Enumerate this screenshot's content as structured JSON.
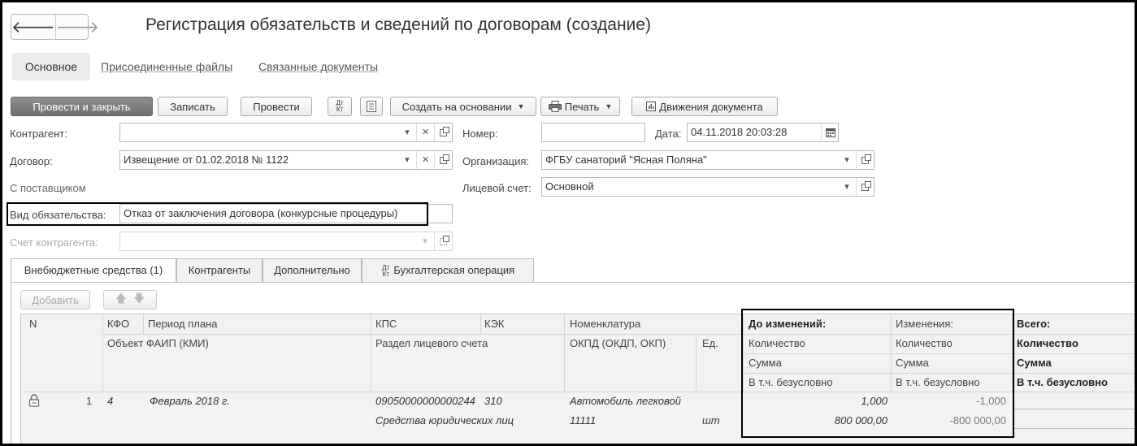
{
  "window": {
    "title": "Регистрация обязательств и сведений по договорам (создание)"
  },
  "nav": {
    "back": "🡐",
    "forward": "🡒"
  },
  "top_tabs": [
    {
      "label": "Основное"
    },
    {
      "label": "Присоединенные файлы"
    },
    {
      "label": "Связанные документы"
    }
  ],
  "toolbar": {
    "post_close": "Провести и закрыть",
    "save": "Записать",
    "post": "Провести",
    "dtkt": "Дт Кт",
    "create_based": "Создать на основании",
    "print": "Печать",
    "movements": "Движения документа"
  },
  "form": {
    "counterparty_label": "Контрагент:",
    "counterparty_value": "",
    "number_label": "Номер:",
    "number_value": "",
    "date_label": "Дата:",
    "date_value": "04.11.2018 20:03:28",
    "contract_label": "Договор:",
    "contract_value": "Извещение от 01.02.2018 № 1122",
    "org_label": "Организация:",
    "org_value": "ФГБУ санаторий \"Ясная Поляна\"",
    "supplier_text": "С поставщиком",
    "account_label": "Лицевой счет:",
    "account_value": "Основной",
    "obligation_label": "Вид обязательства:",
    "obligation_value": "Отказ от заключения договора (конкурсные процедуры)",
    "cp_account_label": "Счет контрагента:",
    "cp_account_value": ""
  },
  "tabs": [
    {
      "label": "Внебюджетные средства (1)"
    },
    {
      "label": "Контрагенты"
    },
    {
      "label": "Дополнительно"
    },
    {
      "label": "Бухгалтерская операция"
    }
  ],
  "grid_toolbar": {
    "add": "Добавить"
  },
  "grid": {
    "headers": {
      "n": "N",
      "kfo": "КФО",
      "period": "Период плана",
      "object": "Объект ФАИП (КМИ)",
      "kps": "КПС",
      "kek": "КЭК",
      "section": "Раздел лицевого счета",
      "nomen": "Номенклатура",
      "okpd": "ОКПД (ОКДП, ОКП)",
      "unit": "Ед.",
      "before": "До изменений:",
      "before_qty": "Количество",
      "before_sum": "Сумма",
      "before_uncond": "В т.ч. безусловно",
      "change": "Изменения:",
      "change_qty": "Количество",
      "change_sum": "Сумма",
      "change_uncond": "В т.ч. безусловно",
      "total": "Всего:",
      "total_qty": "Количество",
      "total_sum": "Сумма",
      "total_uncond": "В т.ч. безусловно"
    },
    "rows": [
      {
        "n": "1",
        "kfo": "4",
        "period": "Февраль 2018 г.",
        "kps": "09050000000000244",
        "kek": "310",
        "nomen": "Автомобиль легковой",
        "section": "Средства юридических лиц",
        "okpd": "11111",
        "unit": "шт",
        "before_qty": "1,000",
        "before_sum": "800 000,00",
        "change_qty": "-1,000",
        "change_sum": "-800 000,00"
      }
    ]
  }
}
